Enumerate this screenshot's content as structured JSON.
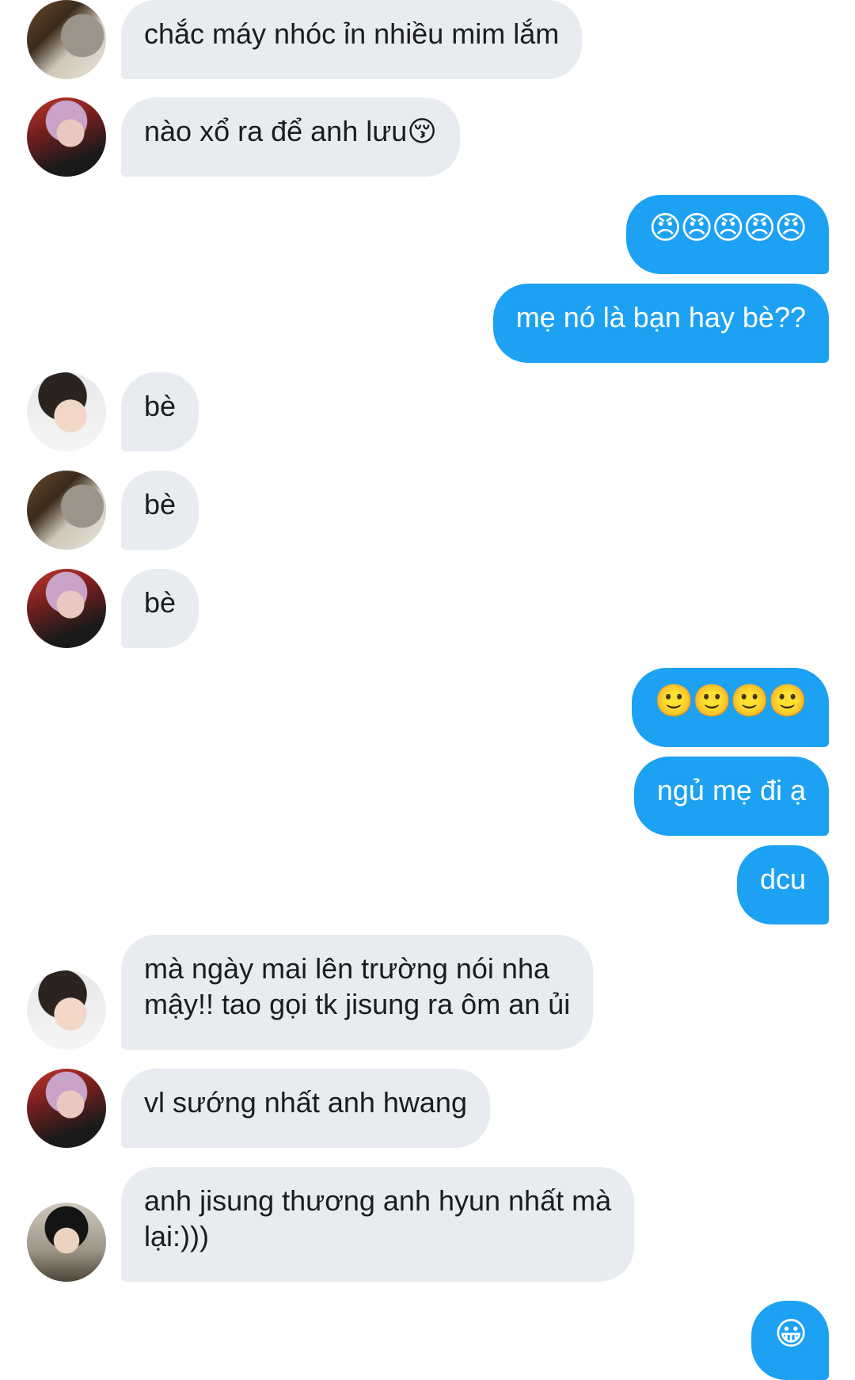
{
  "messages": [
    {
      "side": "in",
      "avatar": "avatar-friend-a",
      "text": "chắc máy nhóc ỉn nhiều mim lắm"
    },
    {
      "side": "in",
      "avatar": "avatar-friend-b",
      "text": "nào xổ ra để anh lưu😚"
    },
    {
      "side": "out",
      "text": "😠😠😠😠😠"
    },
    {
      "side": "out",
      "text": "mẹ nó là bạn hay bè??"
    },
    {
      "side": "in",
      "avatar": "avatar-friend-c",
      "text": "bè"
    },
    {
      "side": "in",
      "avatar": "avatar-friend-a",
      "text": "bè"
    },
    {
      "side": "in",
      "avatar": "avatar-friend-b",
      "text": "bè"
    },
    {
      "side": "out",
      "text": "🙂🙂🙂🙂"
    },
    {
      "side": "out",
      "text": "ngủ mẹ đi ạ"
    },
    {
      "side": "out",
      "text": "dcu"
    },
    {
      "side": "in",
      "avatar": "avatar-friend-c",
      "text": "mà ngày mai lên trường nói nha\nmậy!! tao gọi tk jisung ra ôm an ủi"
    },
    {
      "side": "in",
      "avatar": "avatar-friend-b",
      "text": "vl sướng nhất anh hwang"
    },
    {
      "side": "in",
      "avatar": "avatar-friend-d",
      "text": "anh jisung thương anh hyun nhất mà\nlại:)))"
    },
    {
      "side": "out",
      "text": "😀"
    }
  ],
  "colors": {
    "incoming_bubble": "#e8ecf0",
    "outgoing_bubble": "#1da1f2",
    "incoming_text": "#1c1c1c",
    "outgoing_text": "#ffffff"
  }
}
